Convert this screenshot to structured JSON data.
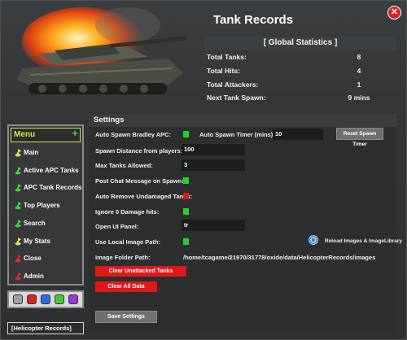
{
  "title": "Tank Records",
  "close_label": "✕",
  "global_stats": {
    "title": "[ Global Statistics ]",
    "rows": [
      {
        "label": "Total Tanks:",
        "value": "8"
      },
      {
        "label": "Total Hits:",
        "value": "4"
      },
      {
        "label": "Total Attackers:",
        "value": "1"
      },
      {
        "label": "Next Tank Spawn:",
        "value": "9 mins"
      }
    ]
  },
  "settings": {
    "header": "Settings",
    "auto_spawn_label": "Auto Spawn Bradley APC:",
    "auto_spawn_timer_label": "Auto Spawn Timer (mins):",
    "auto_spawn_timer_value": "10",
    "reset_spawn_timer_label": "Reset Spawn Timer",
    "spawn_distance_label": "Spawn Distance from players:",
    "spawn_distance_value": "100",
    "max_tanks_label": "Max Tanks Allowed:",
    "max_tanks_value": "3",
    "post_chat_label": "Post Chat Message on Spawn:",
    "auto_remove_label": "Auto Remove Undamaged Tanks:",
    "ignore_zero_label": "Ignore 0 Damage hits:",
    "open_ui_label": "Open UI Panel:",
    "open_ui_value": "tr",
    "use_local_image_label": "Use Local Image Path:",
    "reload_images_label": "Reload Images & ImageLibrary",
    "image_folder_label": "Image Folder Path:",
    "image_folder_value": "/home/tcagame/21970/31778/oxide/data/HelicopterRecords/images",
    "clear_unattacked_label": "Clear Unattacked Tanks",
    "clear_all_label": "Clear All Data",
    "save_label": "Save Settings"
  },
  "menu": {
    "title": "Menu",
    "plus": "+",
    "items": [
      {
        "label": "Main",
        "icon": "radiation-icon",
        "color": "#d8e34a"
      },
      {
        "label": "Active APC Tanks",
        "icon": "radiation-icon",
        "color": "#38d838"
      },
      {
        "label": "APC Tank Records",
        "icon": "radiation-icon",
        "color": "#38d838"
      },
      {
        "label": "Top Players",
        "icon": "radiation-icon",
        "color": "#38d838"
      },
      {
        "label": "Search",
        "icon": "radiation-icon",
        "color": "#38d838"
      },
      {
        "label": "My Stats",
        "icon": "radiation-icon",
        "color": "#d8e34a"
      },
      {
        "label": "Close",
        "icon": "radiation-icon",
        "color": "#e02828"
      },
      {
        "label": "Admin",
        "icon": "radiation-icon",
        "color": "#e02828"
      }
    ]
  },
  "color_swatches": [
    "#9aa0a6",
    "#e02020",
    "#2a6cf0",
    "#48c830",
    "#a030e0"
  ],
  "helicopter_button": "[Helicopter Records]"
}
